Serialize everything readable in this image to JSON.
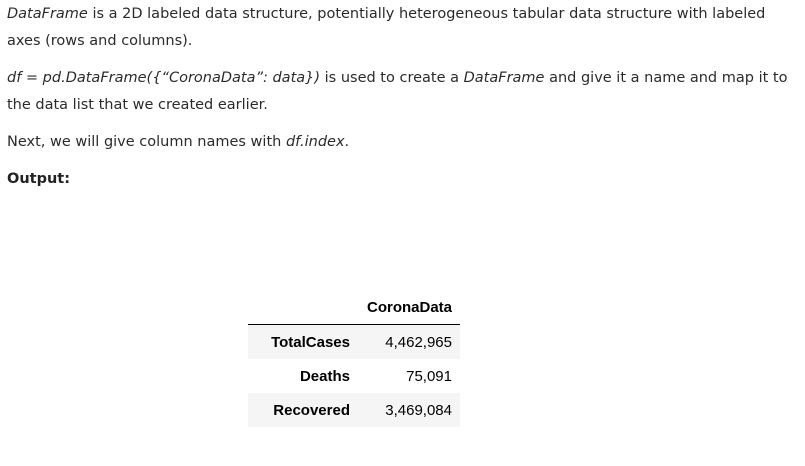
{
  "paragraphs": {
    "p1": {
      "t1": "DataFrame",
      "t2": " is a 2D labeled data structure, potentially heterogeneous tabular data structure with labeled axes (rows and columns)."
    },
    "p2": {
      "t1": "df = pd.DataFrame({“CoronaData”: data})",
      "t2": " is used to create a ",
      "t3": "DataFrame",
      "t4": " and give it a name and map it to the data list that we created earlier."
    },
    "p3": {
      "t1": "Next, we will give column names with ",
      "t2": "df.index",
      "t3": "."
    },
    "p4": {
      "t1": "Output:"
    }
  },
  "table": {
    "column_header": "CoronaData",
    "rows": [
      {
        "label": "TotalCases",
        "value": "4,462,965"
      },
      {
        "label": "Deaths",
        "value": "75,091"
      },
      {
        "label": "Recovered",
        "value": "3,469,084"
      }
    ]
  }
}
